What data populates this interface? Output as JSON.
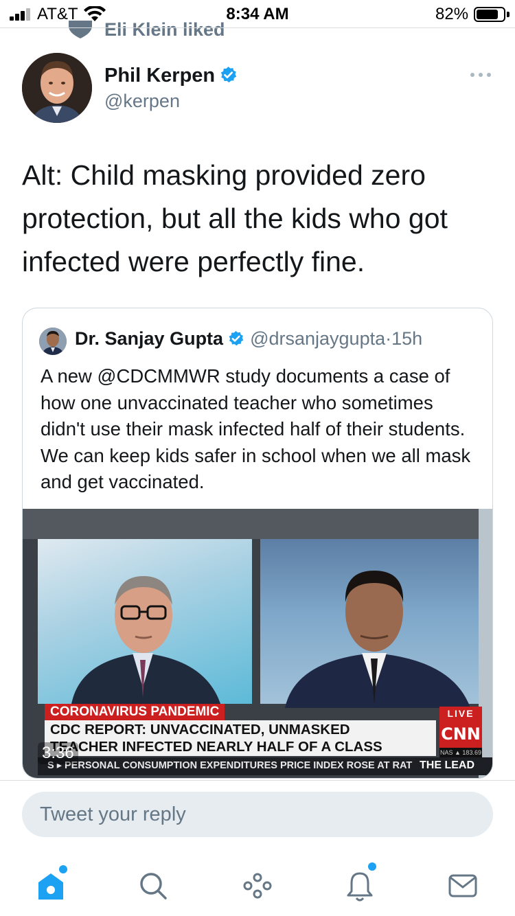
{
  "status_bar": {
    "carrier": "AT&T",
    "time": "8:34 AM",
    "battery_percent": "82%",
    "battery_level": 0.82
  },
  "social_context": {
    "text": "Eli Klein liked"
  },
  "tweet": {
    "author_name": "Phil Kerpen",
    "author_handle": "@kerpen",
    "text": "Alt: Child masking provided zero protection, but all the kids who got infected were perfectly fine.",
    "verified": true
  },
  "quoted_tweet": {
    "author_name": "Dr. Sanjay Gupta",
    "author_handle": "@drsanjaygupta",
    "separator": "·",
    "age": "15h",
    "text": "A new @CDCMMWR study documents a case of how one unvaccinated teacher who sometimes didn't use their mask infected half of their students. We can keep kids safer in school when we all mask and get vaccinated.",
    "video": {
      "duration": "3:36",
      "banner_topic": "CORONAVIRUS PANDEMIC",
      "headline_line1": "CDC REPORT: UNVACCINATED, UNMASKED",
      "headline_line2": "TEACHER INFECTED NEARLY HALF OF A CLASS",
      "live_label": "LIVE",
      "network_logo": "CNN",
      "market_label": "NAS ▲ 183.69",
      "ticker_text": "S ▸ PERSONAL CONSUMPTION EXPENDITURES PRICE INDEX ROSE AT RAT",
      "show_name": "THE LEAD"
    }
  },
  "reply": {
    "placeholder": "Tweet your reply"
  },
  "tab_bar": {
    "items": [
      {
        "icon": "home-icon",
        "active": true,
        "has_badge": true
      },
      {
        "icon": "search-icon",
        "active": false,
        "has_badge": false
      },
      {
        "icon": "spaces-icon",
        "active": false,
        "has_badge": false
      },
      {
        "icon": "notifications-icon",
        "active": false,
        "has_badge": true
      },
      {
        "icon": "messages-icon",
        "active": false,
        "has_badge": false
      }
    ]
  },
  "colors": {
    "accent": "#1da1f2",
    "secondary_text": "#657786",
    "primary_text": "#14171a",
    "cnn_red": "#cc1f1f"
  }
}
